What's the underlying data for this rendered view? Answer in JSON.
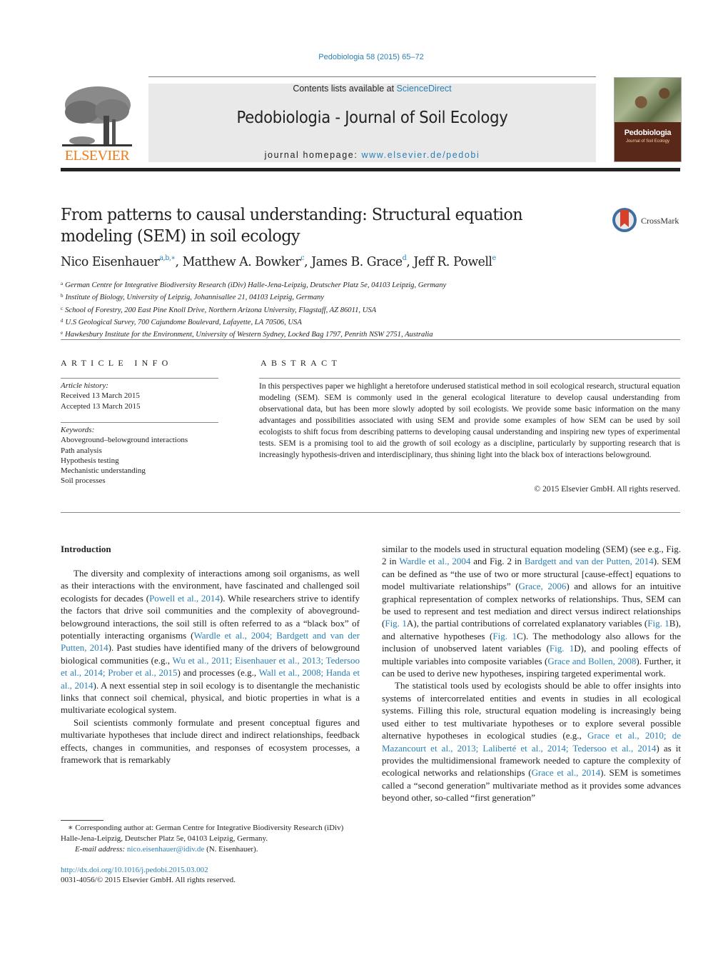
{
  "header": {
    "journal_ref": "Pedobiologia 58 (2015) 65–72",
    "contents_prefix": "Contents lists available at ",
    "contents_link": "ScienceDirect",
    "journal_title": "Pedobiologia - Journal of Soil Ecology",
    "homepage_prefix": "journal homepage: ",
    "homepage_link": "www.elsevier.de/pedobi",
    "publisher_logo_text": "ELSEVIER",
    "cover_title": "Pedobiologia",
    "cover_subtitle": "Journal of Soil Ecology",
    "brand_color": "#f07c1a",
    "link_color": "#2a7fb5"
  },
  "article": {
    "title": "From patterns to causal understanding: Structural equation modeling (SEM) in soil ecology",
    "crossmark_label": "CrossMark",
    "authors": [
      {
        "name": "Nico Eisenhauer",
        "sup": "a,b,∗",
        "sep": ", "
      },
      {
        "name": "Matthew A. Bowker",
        "sup": "c",
        "sep": ", "
      },
      {
        "name": "James B. Grace",
        "sup": "d",
        "sep": ", "
      },
      {
        "name": "Jeff R. Powell",
        "sup": "e",
        "sep": ""
      }
    ],
    "affiliations": [
      {
        "sup": "a",
        "text": "German Centre for Integrative Biodiversity Research (iDiv) Halle-Jena-Leipzig, Deutscher Platz 5e, 04103 Leipzig, Germany"
      },
      {
        "sup": "b",
        "text": "Institute of Biology, University of Leipzig, Johannisallee 21, 04103 Leipzig, Germany"
      },
      {
        "sup": "c",
        "text": "School of Forestry, 200 East Pine Knoll Drive, Northern Arizona University, Flagstaff, AZ 86011, USA"
      },
      {
        "sup": "d",
        "text": "U.S Geological Survey, 700 Cajundome Boulevard, Lafayette, LA 70506, USA"
      },
      {
        "sup": "e",
        "text": "Hawkesbury Institute for the Environment, University of Western Sydney, Locked Bag 1797, Penrith NSW 2751, Australia"
      }
    ]
  },
  "article_info": {
    "heading": "ARTICLE INFO",
    "history_label": "Article history:",
    "received": "Received 13 March 2015",
    "accepted": "Accepted 13 March 2015",
    "keywords_label": "Keywords:",
    "keywords": [
      "Aboveground–belowground interactions",
      "Path analysis",
      "Hypothesis testing",
      "Mechanistic understanding",
      "Soil processes"
    ]
  },
  "abstract": {
    "heading": "ABSTRACT",
    "text": "In this perspectives paper we highlight a heretofore underused statistical method in soil ecological research, structural equation modeling (SEM). SEM is commonly used in the general ecological literature to develop causal understanding from observational data, but has been more slowly adopted by soil ecologists. We provide some basic information on the many advantages and possibilities associated with using SEM and provide some examples of how SEM can be used by soil ecologists to shift focus from describing patterns to developing causal understanding and inspiring new types of experimental tests. SEM is a promising tool to aid the growth of soil ecology as a discipline, particularly by supporting research that is increasingly hypothesis-driven and interdisciplinary, thus shining light into the black box of interactions belowground.",
    "copyright": "© 2015 Elsevier GmbH. All rights reserved."
  },
  "body": {
    "section_heading": "Introduction",
    "left_paragraphs": [
      [
        {
          "t": "The diversity and complexity of interactions among soil organisms, as well as their interactions with the environment, have fascinated and challenged soil ecologists for decades ("
        },
        {
          "t": "Powell et al., 2014",
          "link": true
        },
        {
          "t": "). While researchers strive to identify the factors that drive soil communities and the complexity of aboveground-belowground interactions, the soil still is often referred to as a “black box” of potentially interacting organisms ("
        },
        {
          "t": "Wardle et al., 2004; Bardgett and van der Putten, 2014",
          "link": true
        },
        {
          "t": "). Past studies have identified many of the drivers of belowground biological communities (e.g., "
        },
        {
          "t": "Wu et al., 2011; Eisenhauer et al., 2013; Tedersoo et al., 2014; Prober et al., 2015",
          "link": true
        },
        {
          "t": ") and processes (e.g., "
        },
        {
          "t": "Wall et al., 2008; Handa et al., 2014",
          "link": true
        },
        {
          "t": "). A next essential step in soil ecology is to disentangle the mechanistic links that connect soil chemical, physical, and biotic properties in what is a multivariate ecological system."
        }
      ],
      [
        {
          "t": "Soil scientists commonly formulate and present conceptual figures and multivariate hypotheses that include direct and indirect relationships, feedback effects, changes in communities, and responses of ecosystem processes, a framework that is remarkably"
        }
      ]
    ],
    "right_paragraphs": [
      [
        {
          "t": "similar to the models used in structural equation modeling (SEM) (see e.g., Fig. 2 in "
        },
        {
          "t": "Wardle et al., 2004",
          "link": true
        },
        {
          "t": " and Fig. 2 in "
        },
        {
          "t": "Bardgett and van der Putten, 2014",
          "link": true
        },
        {
          "t": "). SEM can be defined as “the use of two or more structural [cause-effect] equations to model multivariate relationships” ("
        },
        {
          "t": "Grace, 2006",
          "link": true
        },
        {
          "t": ") and allows for an intuitive graphical representation of complex networks of relationships. Thus, SEM can be used to represent and test mediation and direct versus indirect relationships ("
        },
        {
          "t": "Fig. 1",
          "link": true
        },
        {
          "t": "A), the partial contributions of correlated explanatory variables ("
        },
        {
          "t": "Fig. 1",
          "link": true
        },
        {
          "t": "B), and alternative hypotheses ("
        },
        {
          "t": "Fig. 1",
          "link": true
        },
        {
          "t": "C). The methodology also allows for the inclusion of unobserved latent variables ("
        },
        {
          "t": "Fig. 1",
          "link": true
        },
        {
          "t": "D), and pooling effects of multiple variables into composite variables ("
        },
        {
          "t": "Grace and Bollen, 2008",
          "link": true
        },
        {
          "t": "). Further, it can be used to derive new hypotheses, inspiring targeted experimental work."
        }
      ],
      [
        {
          "t": "The statistical tools used by ecologists should be able to offer insights into systems of intercorrelated entities and events in studies in all ecological systems. Filling this role, structural equation modeling is increasingly being used either to test multivariate hypotheses or to explore several possible alternative hypotheses in ecological studies (e.g., "
        },
        {
          "t": "Grace et al., 2010; de Mazancourt et al., 2013; Laliberté et al., 2014; Tedersoo et al., 2014",
          "link": true
        },
        {
          "t": ") as it provides the multidimensional framework needed to capture the complexity of ecological networks and relationships ("
        },
        {
          "t": "Grace et al., 2014",
          "link": true
        },
        {
          "t": "). SEM is sometimes called a “second generation” multivariate method as it provides some advances beyond other, so-called “first generation”"
        }
      ]
    ]
  },
  "footnotes": {
    "corresponding": "∗ Corresponding author at: German Centre for Integrative Biodiversity Research (iDiv) Halle-Jena-Leipzig, Deutscher Platz 5e, 04103 Leipzig, Germany.",
    "email_label": "E-mail address:",
    "email": "nico.eisenhauer@idiv.de",
    "email_suffix": " (N. Eisenhauer).",
    "doi": "http://dx.doi.org/10.1016/j.pedobi.2015.03.002",
    "issn": "0031-4056/© 2015 Elsevier GmbH. All rights reserved."
  }
}
